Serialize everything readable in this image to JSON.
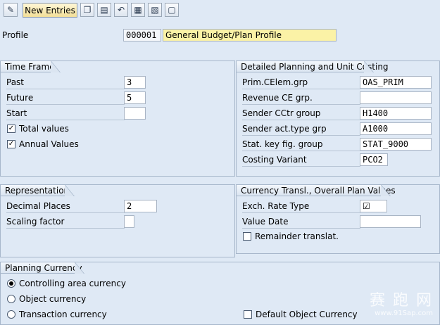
{
  "toolbar": {
    "new_entries_label": "New Entries",
    "icons": [
      "pencil-glasses-icon",
      "copy-icon",
      "delete-icon",
      "undo-icon",
      "select-all-icon",
      "select-block-icon",
      "deselect-icon"
    ]
  },
  "profile": {
    "label": "Profile",
    "id": "000001",
    "description": "General Budget/Plan Profile"
  },
  "time_frame": {
    "title": "Time Frame",
    "past_label": "Past",
    "past_value": "3",
    "future_label": "Future",
    "future_value": "5",
    "start_label": "Start",
    "start_value": "",
    "total_values_label": "Total values",
    "total_values_checked": true,
    "annual_values_label": "Annual Values",
    "annual_values_checked": true
  },
  "detailed": {
    "title": "Detailed Planning and Unit Costing",
    "rows": [
      {
        "label": "Prim.CElem.grp",
        "value": "OAS_PRIM"
      },
      {
        "label": "Revenue CE grp.",
        "value": ""
      },
      {
        "label": "Sender CCtr group",
        "value": "H1400"
      },
      {
        "label": "Sender act.type grp",
        "value": "A1000"
      },
      {
        "label": "Stat. key fig. group",
        "value": "STAT_9000"
      },
      {
        "label": "Costing Variant",
        "value": "PCO2"
      }
    ]
  },
  "representation": {
    "title": "Representation",
    "decimal_label": "Decimal Places",
    "decimal_value": "2",
    "scaling_label": "Scaling factor",
    "scaling_value": ""
  },
  "currency_transl": {
    "title": "Currency Transl., Overall Plan Values",
    "exch_label": "Exch. Rate Type",
    "exch_value": "☑",
    "date_label": "Value Date",
    "date_value": "",
    "remainder_label": "Remainder translat.",
    "remainder_checked": false
  },
  "planning_currency": {
    "title": "Planning Currency",
    "options": [
      {
        "label": "Controlling area currency",
        "selected": true
      },
      {
        "label": "Object currency",
        "selected": false
      },
      {
        "label": "Transaction currency",
        "selected": false
      }
    ],
    "default_object_label": "Default Object Currency",
    "default_object_checked": false
  },
  "watermark": {
    "line1": "赛 跑 网",
    "line2": "www.91Sap.com"
  }
}
